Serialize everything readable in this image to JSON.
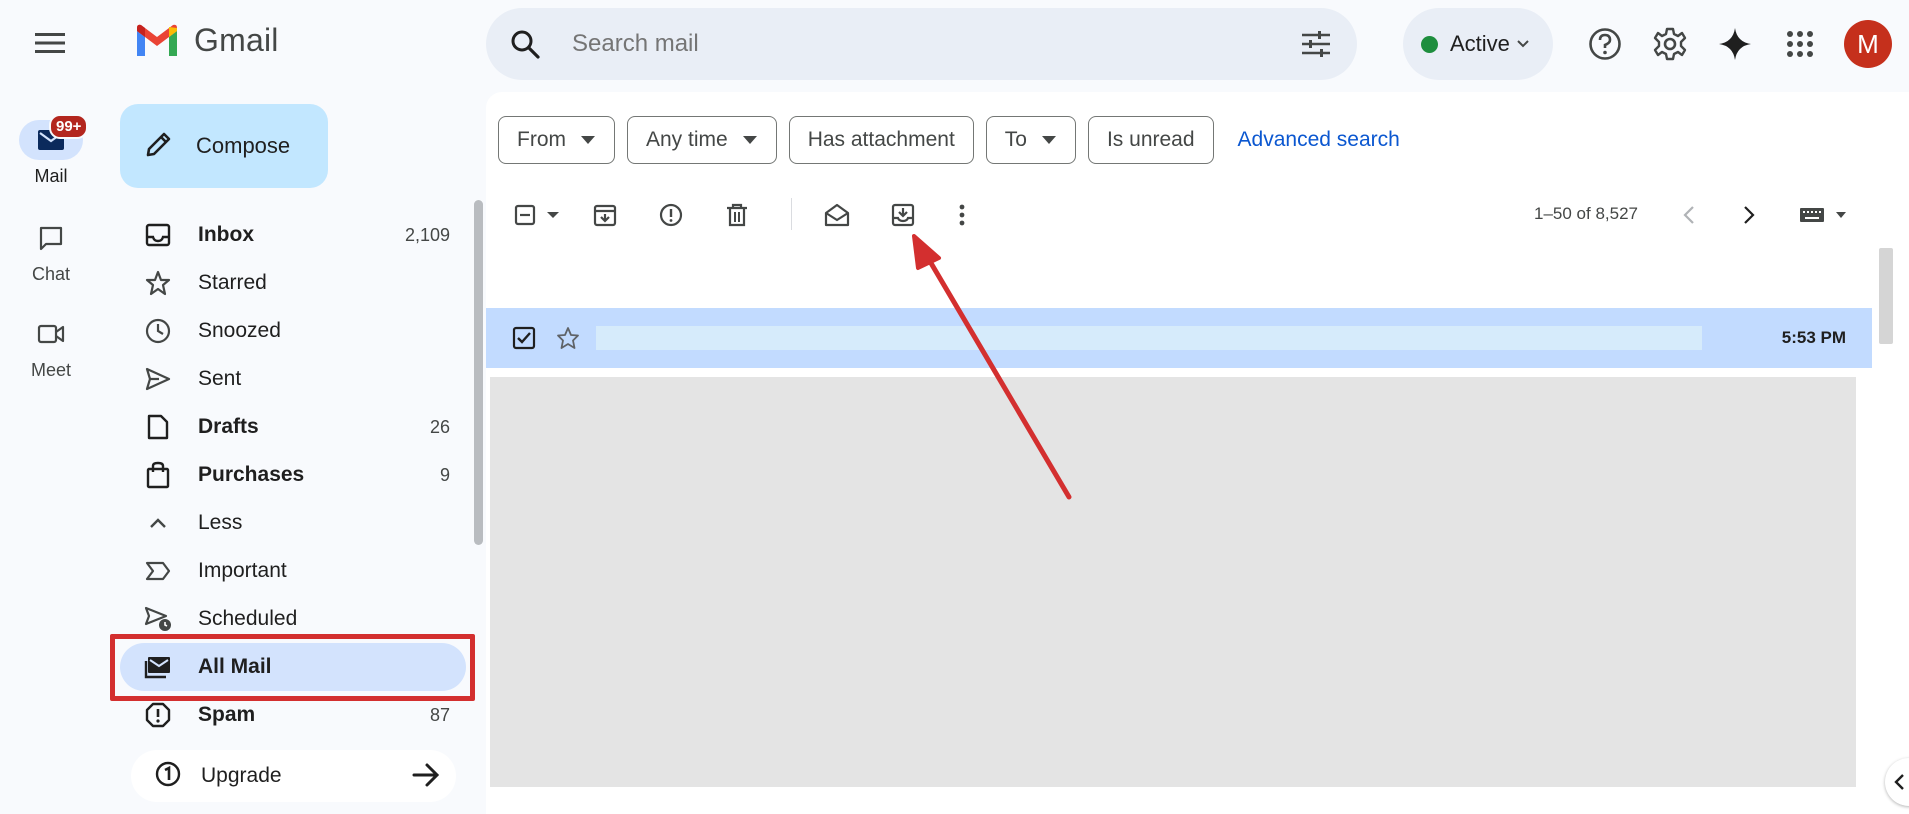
{
  "app": {
    "name": "Gmail"
  },
  "rail": {
    "items": [
      {
        "label": "Mail",
        "badge": "99+",
        "icon": "mail-icon"
      },
      {
        "label": "Chat",
        "icon": "chat-icon"
      },
      {
        "label": "Meet",
        "icon": "video-icon"
      }
    ]
  },
  "search": {
    "placeholder": "Search mail"
  },
  "status": {
    "label": "Active",
    "color": "#1e8e3e"
  },
  "avatar": {
    "letter": "M",
    "color": "#c5301c"
  },
  "compose": {
    "label": "Compose"
  },
  "nav": {
    "items": [
      {
        "label": "Inbox",
        "count": "2,109",
        "icon": "inbox-icon"
      },
      {
        "label": "Starred",
        "count": "",
        "icon": "star-icon"
      },
      {
        "label": "Snoozed",
        "count": "",
        "icon": "clock-icon"
      },
      {
        "label": "Sent",
        "count": "",
        "icon": "send-icon"
      },
      {
        "label": "Drafts",
        "count": "26",
        "icon": "draft-icon"
      },
      {
        "label": "Purchases",
        "count": "9",
        "icon": "shopping-bag-icon"
      },
      {
        "label": "Less",
        "count": "",
        "icon": "chevron-up-icon"
      },
      {
        "label": "Important",
        "count": "",
        "icon": "important-icon"
      },
      {
        "label": "Scheduled",
        "count": "",
        "icon": "scheduled-icon"
      },
      {
        "label": "All Mail",
        "count": "",
        "icon": "all-mail-icon"
      },
      {
        "label": "Spam",
        "count": "87",
        "icon": "spam-icon"
      }
    ]
  },
  "upgrade": {
    "label": "Upgrade"
  },
  "filters": {
    "chips": [
      "From",
      "Any time",
      "Has attachment",
      "To",
      "Is unread"
    ],
    "advanced": "Advanced search"
  },
  "toolbar": {
    "pager": "1–50 of 8,527"
  },
  "selected_row": {
    "time": "5:53 PM"
  },
  "colors": {
    "accent": "#0b57d0",
    "selected_nav": "#d3e3fd",
    "compose_bg": "#c2e7ff",
    "annotation": "#d32f2f"
  }
}
